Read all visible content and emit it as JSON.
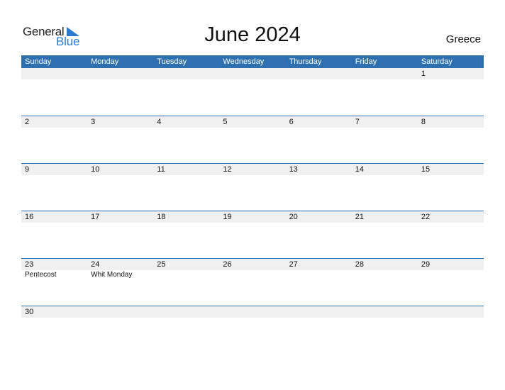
{
  "logo": {
    "general": "General",
    "blue": "Blue"
  },
  "title": "June 2024",
  "country": "Greece",
  "weekdays": [
    "Sunday",
    "Monday",
    "Tuesday",
    "Wednesday",
    "Thursday",
    "Friday",
    "Saturday"
  ],
  "weeks": [
    {
      "days": [
        "",
        "",
        "",
        "",
        "",
        "",
        "1"
      ],
      "events": [
        "",
        "",
        "",
        "",
        "",
        "",
        ""
      ]
    },
    {
      "days": [
        "2",
        "3",
        "4",
        "5",
        "6",
        "7",
        "8"
      ],
      "events": [
        "",
        "",
        "",
        "",
        "",
        "",
        ""
      ]
    },
    {
      "days": [
        "9",
        "10",
        "11",
        "12",
        "13",
        "14",
        "15"
      ],
      "events": [
        "",
        "",
        "",
        "",
        "",
        "",
        ""
      ]
    },
    {
      "days": [
        "16",
        "17",
        "18",
        "19",
        "20",
        "21",
        "22"
      ],
      "events": [
        "",
        "",
        "",
        "",
        "",
        "",
        ""
      ]
    },
    {
      "days": [
        "23",
        "24",
        "25",
        "26",
        "27",
        "28",
        "29"
      ],
      "events": [
        "Pentecost",
        "Whit Monday",
        "",
        "",
        "",
        "",
        ""
      ]
    },
    {
      "days": [
        "30",
        "",
        "",
        "",
        "",
        "",
        ""
      ],
      "events": [
        "",
        "",
        "",
        "",
        "",
        "",
        ""
      ]
    }
  ],
  "colors": {
    "header": "#2e6faf",
    "brand_blue": "#2a7ad0",
    "strip": "#f0f0f0"
  }
}
